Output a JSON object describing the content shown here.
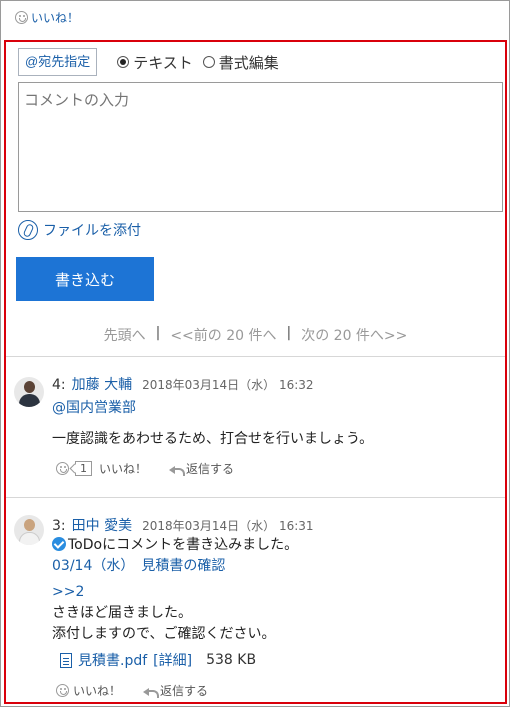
{
  "top": {
    "like_label": "いいね！"
  },
  "form": {
    "mention_button": "@宛先指定",
    "mode_text": "テキスト",
    "mode_rich": "書式編集",
    "comment_placeholder": "コメントの入力",
    "attach_label": "ファイルを添付",
    "submit_label": "書き込む"
  },
  "pager": {
    "first": "先頭へ",
    "prev": "<<前の 20 件へ",
    "next": "次の 20 件へ>>",
    "separator": "|"
  },
  "comments": [
    {
      "number": "4:",
      "author": "加藤 大輔",
      "datetime": "2018年03月14日（水） 16:32",
      "mention": "@国内営業部",
      "body": "一度認識をあわせるため、打合せを行いましょう。",
      "like_count": "1",
      "like_label": "いいね！",
      "reply_label": "返信する"
    },
    {
      "number": "3:",
      "author": "田中 愛美",
      "datetime": "2018年03月14日（水） 16:31",
      "todo_text": "ToDoにコメントを書き込みました。",
      "todo_link": "03/14（水）　見積書の確認",
      "reply_ref": ">>2",
      "body_line1": "さきほど届きました。",
      "body_line2": "添付しますので、ご確認ください。",
      "file_name": "見積書.pdf",
      "file_detail": "[詳細]",
      "file_size": "538 KB",
      "like_label": "いいね！",
      "reply_label": "返信する"
    }
  ],
  "colors": {
    "accent": "#1d74d5",
    "link": "#1a5fa8",
    "highlight_border": "#d9000b"
  }
}
